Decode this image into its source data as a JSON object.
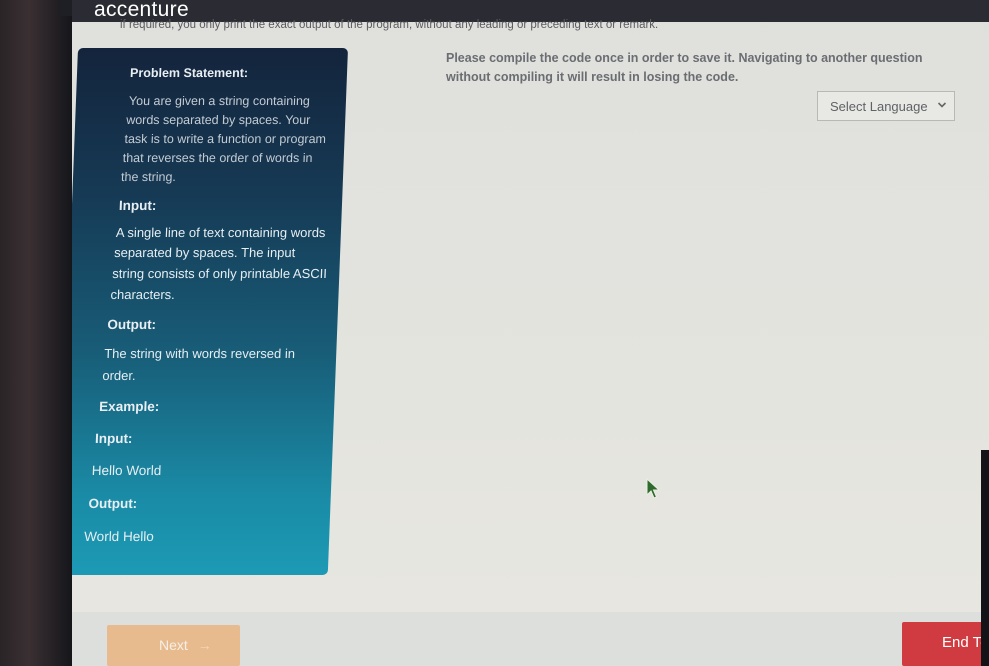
{
  "header": {
    "brand": "accenture",
    "instruction": "if required, you only print the exact output of the program, without any leading or preceding text or remark."
  },
  "problem": {
    "statement_heading": "Problem Statement:",
    "statement_lines": [
      "You are given a string containing",
      "words separated by spaces. Your",
      "task is to write a function or program",
      "that reverses the order of words in",
      "the string."
    ],
    "input_heading": "Input:",
    "input_lines": [
      "A single line of text containing words",
      "separated by spaces. The input",
      "string consists of only printable ASCII",
      "characters."
    ],
    "output_heading": "Output:",
    "output_lines": [
      "The string with words reversed in",
      "order."
    ],
    "example_heading": "Example:",
    "example_input_heading": "Input:",
    "example_input_value": "Hello World",
    "example_output_heading": "Output:",
    "example_output_value": "World Hello"
  },
  "editor": {
    "compile_note_line1": "Please compile the code once in order to save it. Navigating to another question",
    "compile_note_line2": "without compiling it will result in losing the code.",
    "language_select": {
      "selected": "Select Language",
      "icon": "chevron-down-icon"
    }
  },
  "footer": {
    "next_label": "Next",
    "next_icon": "arrow-right-icon",
    "end_label": "End Te"
  },
  "colors": {
    "card_top": "#14243c",
    "card_bottom": "#1c9ab5",
    "next_button": "#e8bb8e",
    "end_button": "#cf3b40"
  }
}
